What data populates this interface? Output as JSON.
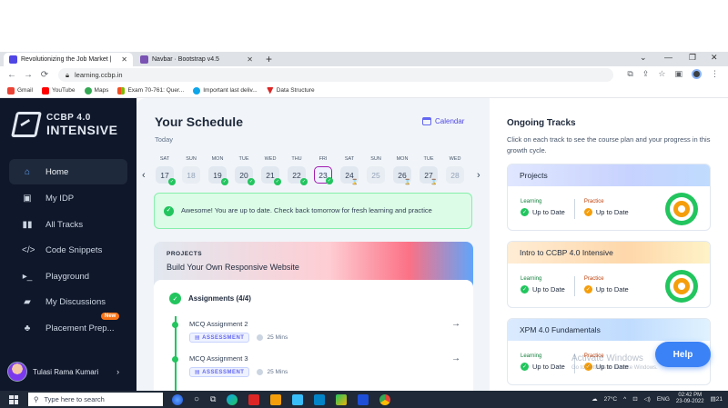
{
  "browser": {
    "tabs": [
      {
        "label": "Revolutionizing the Job Market |",
        "close": "✕",
        "active": true,
        "favicon_color": "#4f46e5"
      },
      {
        "label": "Navbar · Bootstrap v4.5",
        "close": "✕",
        "active": false,
        "favicon_color": "#7952b3"
      }
    ],
    "new_tab": "+",
    "url": "learning.ccbp.in",
    "bookmarks": [
      {
        "label": "Gmail",
        "color": "#ea4335"
      },
      {
        "label": "YouTube",
        "color": "#ff0000"
      },
      {
        "label": "Maps",
        "color": "#34a853"
      },
      {
        "label": "Exam 70-761: Quer...",
        "color": "#f25022"
      },
      {
        "label": "Important last deliv...",
        "color": "#0ea5e9"
      },
      {
        "label": "Data Structure",
        "color": "#dc2626"
      }
    ]
  },
  "sidebar": {
    "brand_line1": "CCBP 4.0",
    "brand_line2": "INTENSIVE",
    "items": [
      {
        "label": "Home",
        "icon": "home-icon",
        "active": true
      },
      {
        "label": "My IDP",
        "icon": "idp-icon",
        "active": false
      },
      {
        "label": "All Tracks",
        "icon": "tracks-icon",
        "active": false
      },
      {
        "label": "Code Snippets",
        "icon": "code-icon",
        "active": false
      },
      {
        "label": "Playground",
        "icon": "terminal-icon",
        "active": false
      },
      {
        "label": "My Discussions",
        "icon": "discussion-icon",
        "active": false
      },
      {
        "label": "Placement Prep...",
        "icon": "placement-icon",
        "active": false
      }
    ],
    "new_badge": "New",
    "user_name": "Tulasi Rama Kumari"
  },
  "schedule": {
    "title": "Your Schedule",
    "subtitle": "Today",
    "calendar_link": "Calendar",
    "days": [
      {
        "name": "SAT",
        "date": "17",
        "status": "done"
      },
      {
        "name": "SUN",
        "date": "18",
        "status": "none"
      },
      {
        "name": "MON",
        "date": "19",
        "status": "done"
      },
      {
        "name": "TUE",
        "date": "20",
        "status": "done"
      },
      {
        "name": "WED",
        "date": "21",
        "status": "done"
      },
      {
        "name": "THU",
        "date": "22",
        "status": "done"
      },
      {
        "name": "FRI",
        "date": "23",
        "status": "done",
        "selected": true
      },
      {
        "name": "SAT",
        "date": "24",
        "status": "pending"
      },
      {
        "name": "SUN",
        "date": "25",
        "status": "none"
      },
      {
        "name": "MON",
        "date": "26",
        "status": "pending"
      },
      {
        "name": "TUE",
        "date": "27",
        "status": "pending"
      },
      {
        "name": "WED",
        "date": "28",
        "status": "none"
      }
    ],
    "alert": "Awesome! You are up to date. Check back tomorrow for fresh learning and practice",
    "project_kind": "PROJECTS",
    "project_name": "Build Your Own Responsive Website",
    "assignments_header": "Assignments (4/4)",
    "assignments": [
      {
        "name": "MCQ Assignment 2",
        "tag": "ASSESSMENT",
        "duration": "25 Mins"
      },
      {
        "name": "MCQ Assignment 3",
        "tag": "ASSESSMENT",
        "duration": "25 Mins"
      }
    ]
  },
  "tracks": {
    "title": "Ongoing Tracks",
    "description": "Click on each track to see the course plan and your progress in this growth cycle.",
    "items": [
      {
        "name": "Projects",
        "header_color": "#c7d2fe",
        "learning_label": "Learning",
        "learning_value": "Up to Date",
        "practice_label": "Practice",
        "practice_value": "Up to Date"
      },
      {
        "name": "Intro to CCBP 4.0 Intensive",
        "header_color": "#fed7aa",
        "learning_label": "Learning",
        "learning_value": "Up to Date",
        "practice_label": "Practice",
        "practice_value": "Up to Date"
      },
      {
        "name": "XPM 4.0 Fundamentals",
        "header_color": "#bfdbfe",
        "learning_label": "Learning",
        "learning_value": "Up to Date",
        "practice_label": "Practice",
        "practice_value": "Up to Date"
      }
    ],
    "help_button": "Help",
    "watermark1": "Activate Windows",
    "watermark2": "Go to Settings to activate Windows."
  },
  "taskbar": {
    "search_placeholder": "Type here to search",
    "weather": "27°C",
    "lang": "ENG",
    "time": "02:42 PM",
    "date": "23-09-2022",
    "notif_count": "21"
  },
  "colors": {
    "sidebar_bg": "#0f172a",
    "accent": "#3b82f6",
    "success": "#22c55e"
  }
}
